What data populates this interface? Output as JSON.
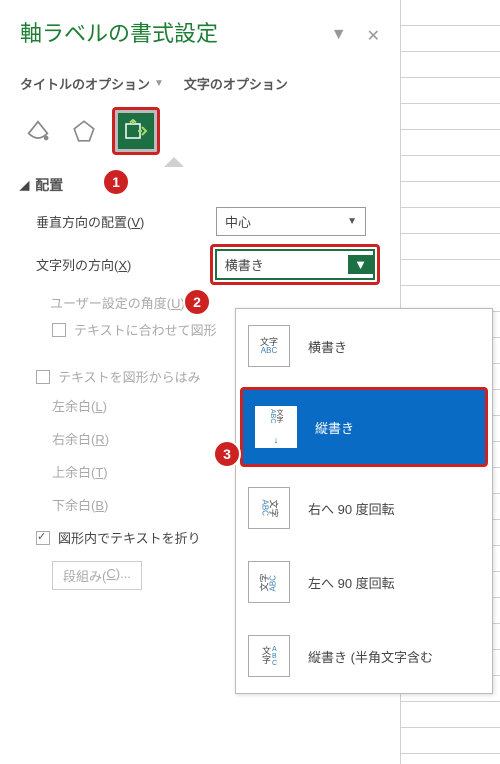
{
  "panel": {
    "title": "軸ラベルの書式設定",
    "tabs": {
      "title_options": "タイトルのオプション",
      "text_options": "文字のオプション"
    },
    "section": "配置",
    "fields": {
      "vertical_align": {
        "label": "垂直方向の配置(V)",
        "value": "中心",
        "key": "V"
      },
      "text_direction": {
        "label": "文字列の方向(X)",
        "value": "横書き",
        "key": "X"
      },
      "custom_angle": {
        "label": "ユーザー設定の角度(U)",
        "key": "U"
      },
      "fit_shape": "テキストに合わせて図形",
      "no_overflow": "テキストを図形からはみ",
      "margin_left": {
        "label": "左余白(L)",
        "key": "L"
      },
      "margin_right": {
        "label": "右余白(R)",
        "key": "R"
      },
      "margin_top": {
        "label": "上余白(T)",
        "key": "T"
      },
      "margin_bottom": {
        "label": "下余白(B)",
        "key": "B"
      },
      "wrap_text": "図形内でテキストを折り",
      "columns": {
        "label": "段組み(C)...",
        "key": "C"
      }
    },
    "badges": {
      "b1": "1",
      "b2": "2",
      "b3": "3"
    }
  },
  "dropdown": {
    "items": [
      {
        "icon_top": "文字",
        "icon_bottom": "ABC",
        "label": "横書き"
      },
      {
        "icon_lines": true,
        "label": "縦書き"
      },
      {
        "icon_rot_right": true,
        "label": "右へ 90 度回転"
      },
      {
        "icon_rot_left": true,
        "label": "左へ 90 度回転"
      },
      {
        "icon_vert_abc": true,
        "label": "縦書き (半角文字含む"
      }
    ]
  }
}
